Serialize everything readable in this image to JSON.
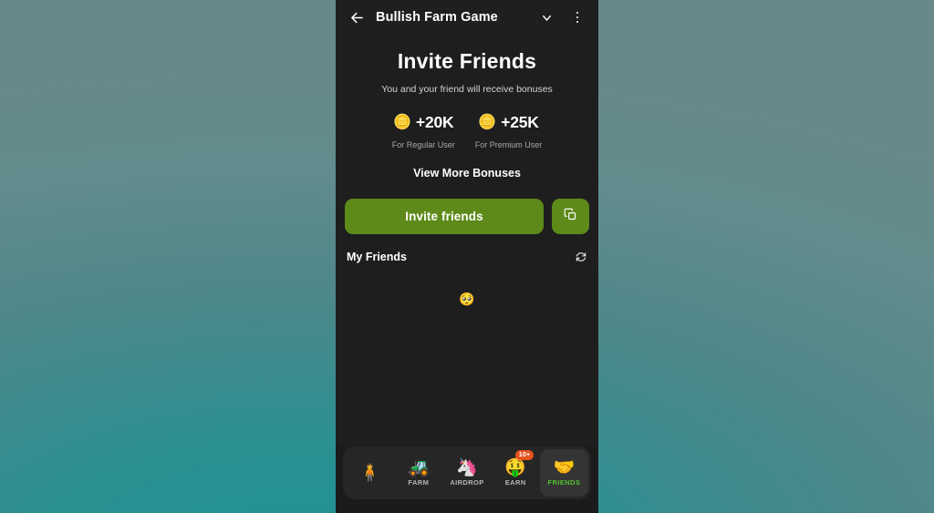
{
  "header": {
    "back_icon": "back-arrow-icon",
    "title": "Bullish Farm Game",
    "collapse_icon": "chevron-down-icon",
    "menu_icon": "kebab-menu-icon"
  },
  "invite": {
    "title": "Invite Friends",
    "subtitle": "You and your friend will receive bonuses",
    "bonuses": [
      {
        "icon": "coin-icon",
        "amount": "+20K",
        "caption": "For Regular User"
      },
      {
        "icon": "coin-icon",
        "amount": "+25K",
        "caption": "For Premium User"
      }
    ],
    "view_more_label": "View More Bonuses",
    "invite_button_label": "Invite friends",
    "copy_button_icon": "copy-icon"
  },
  "friends": {
    "section_title": "My Friends",
    "refresh_icon": "refresh-icon",
    "empty_emoji": "🥺"
  },
  "bottom_nav": [
    {
      "icon": "🧍",
      "name": "nav-item-character",
      "label": "",
      "badge": "",
      "active": false
    },
    {
      "icon": "🚜",
      "name": "nav-item-farm",
      "label": "FARM",
      "badge": "",
      "active": false
    },
    {
      "icon": "🦄",
      "name": "nav-item-airdrop",
      "label": "AIRDROP",
      "badge": "",
      "active": false
    },
    {
      "icon": "🤑",
      "name": "nav-item-earn",
      "label": "EARN",
      "badge": "10+",
      "active": false
    },
    {
      "icon": "🤝",
      "name": "nav-item-friends",
      "label": "FRIENDS",
      "badge": "",
      "active": true
    }
  ],
  "colors": {
    "accent_green": "#5d8a19",
    "active_label_green": "#55c033",
    "badge_orange": "#e8521d",
    "panel_dark": "#1e1e1e",
    "nav_bar": "#262626"
  }
}
